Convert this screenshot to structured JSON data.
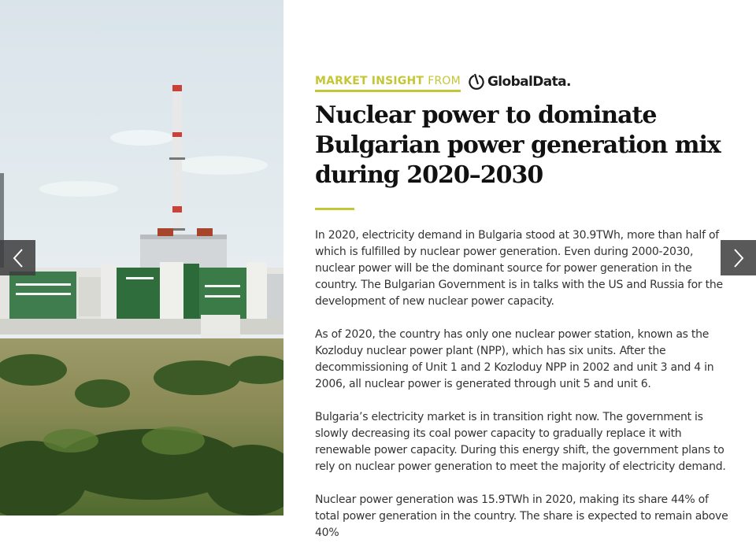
{
  "photo": {
    "alt_icon": "nuclear-plant-photo"
  },
  "nav": {
    "prev_icon": "chevron-left-icon",
    "next_icon": "chevron-right-icon"
  },
  "header": {
    "kicker_bold": "MARKET INSIGHT",
    "kicker_light": "FROM",
    "brand_name": "GlobalData.",
    "brand_color": "#c4c733"
  },
  "article": {
    "title": "Nuclear power to dominate Bulgarian power generation mix during 2020–2030",
    "paragraphs": [
      "In 2020, electricity demand in Bulgaria stood at 30.9TWh, more than half of which is fulfilled by nuclear power generation. Even during 2000-2030, nuclear power will be the dominant source for power generation in the country. The Bulgarian Government is in talks with the US and Russia for the development of new nuclear power capacity.",
      "As of 2020, the country has only one nuclear power station, known as the Kozloduy nuclear power plant (NPP), which has six units. After the decommissioning of Unit 1 and 2 Kozloduy NPP in 2002 and unit 3 and 4 in 2006, all nuclear power is generated through unit 5 and unit 6.",
      "Bulgaria’s electricity market is in transition right now. The government is slowly decreasing its coal power capacity to gradually replace it with renewable power capacity. During this energy shift, the government plans to rely on nuclear power generation to meet the majority of electricity demand.",
      "Nuclear power generation was 15.9TWh in 2020, making its share 44% of total power generation in the country. The share is expected to remain above 40%"
    ]
  }
}
